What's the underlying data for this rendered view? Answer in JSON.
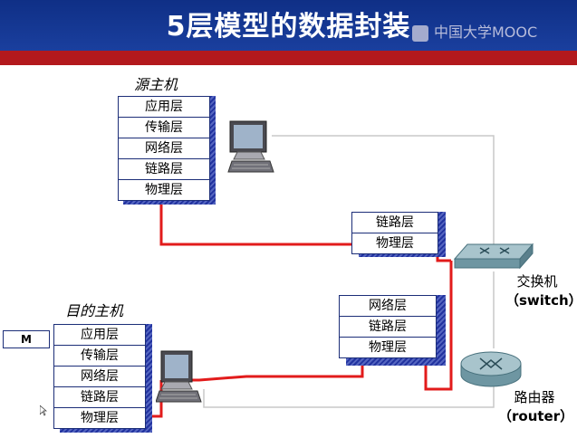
{
  "header": {
    "title": "5层模型的数据封装",
    "watermark": "中国大学MOOC"
  },
  "source_host": {
    "label": "源主机",
    "layers": [
      "应用层",
      "传输层",
      "网络层",
      "链路层",
      "物理层"
    ]
  },
  "dest_host": {
    "label": "目的主机",
    "layers": [
      "应用层",
      "传输层",
      "网络层",
      "链路层",
      "物理层"
    ]
  },
  "switch_stack": {
    "layers": [
      "链路层",
      "物理层"
    ]
  },
  "router_stack": {
    "layers": [
      "网络层",
      "链路层",
      "物理层"
    ]
  },
  "switch": {
    "name": "交换机",
    "english": "（switch）"
  },
  "router": {
    "name": "路由器",
    "english": "（router）"
  },
  "message_box": {
    "label": "M"
  },
  "icons": [
    "computer-icon",
    "switch-icon",
    "router-icon",
    "mouse-cursor-icon"
  ],
  "colors": {
    "header_blue": "#1a3f9e",
    "header_red": "#b3191d",
    "path_red": "#e21b1b",
    "stack_border": "#1c2e78"
  }
}
